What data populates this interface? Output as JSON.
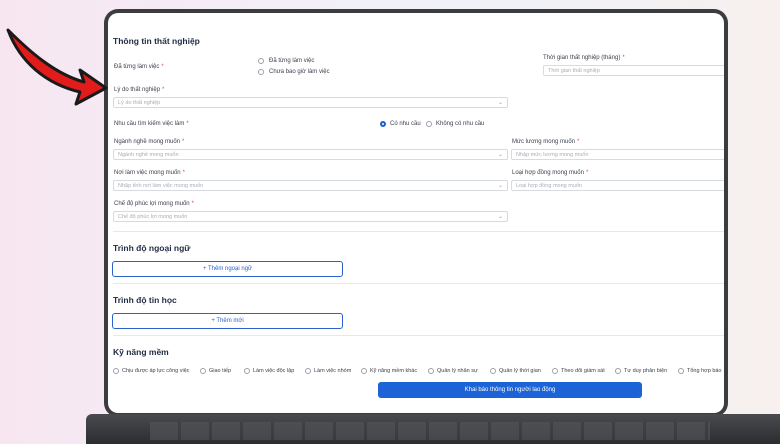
{
  "sections": {
    "unemployment": {
      "title": "Thông tin thất nghiệp",
      "worked_label": "Đã từng làm việc",
      "worked_options": [
        "Đã từng làm việc",
        "Chưa bao giờ làm việc"
      ],
      "duration_label": "Thời gian thất nghiệp (tháng)",
      "duration_placeholder": "Thời gian thất nghiệp",
      "reason_label": "Lý do thất nghiệp",
      "reason_placeholder": "Lý do thất nghiệp",
      "need_label": "Nhu cầu tìm kiếm việc làm",
      "need_options": [
        "Có nhu cầu",
        "Không có nhu cầu"
      ],
      "need_selected": "Có nhu cầu",
      "industry_label": "Ngành nghề mong muốn",
      "industry_placeholder": "Ngành nghề mong muốn",
      "salary_label": "Mức lương mong muốn",
      "salary_placeholder": "Nhập mức lương mong muốn",
      "location_label": "Nơi làm việc mong muốn",
      "location_placeholder": "Nhập tỉnh nơi làm việc mong muốn",
      "contract_label": "Loại hợp đồng mong muốn",
      "contract_placeholder": "Loại hợp đồng mong muốn",
      "welfare_label": "Chế độ phúc lợi mong muốn",
      "welfare_placeholder": "Chế độ phúc lợi mong muốn"
    },
    "language": {
      "title": "Trình độ ngoại ngữ",
      "add_label": "Thêm ngoại ngữ"
    },
    "it": {
      "title": "Trình độ tin học",
      "add_label": "Thêm mới"
    },
    "soft_skills": {
      "title": "Kỹ năng mềm",
      "items": [
        "Chịu được áp lực công việc",
        "Giao tiếp",
        "Làm việc độc lập",
        "Làm việc nhóm",
        "Kỹ năng mềm khác",
        "Quản lý nhân sự",
        "Quản lý thời gian",
        "Theo dõi giám sát",
        "Tư duy phản biện",
        "Tổng hợp báo"
      ]
    }
  },
  "submit_label": "Khai báo thông tin người lao động",
  "required_mark": "*",
  "colors": {
    "accent": "#1b63d6",
    "required": "#e04848"
  }
}
